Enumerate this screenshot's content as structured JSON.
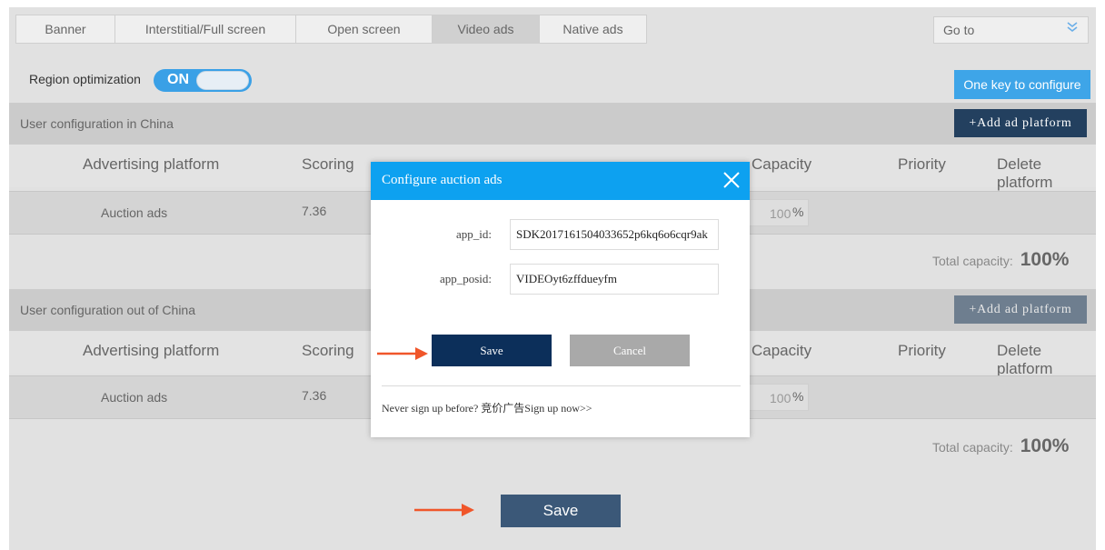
{
  "tabs": [
    {
      "label": "Banner",
      "active": false
    },
    {
      "label": "Interstitial/Full screen",
      "active": false
    },
    {
      "label": "Open screen",
      "active": false
    },
    {
      "label": "Video ads",
      "active": true
    },
    {
      "label": "Native ads",
      "active": false
    }
  ],
  "goto": {
    "label": "Go to",
    "icon": "double-chevron-down-icon"
  },
  "region": {
    "label": "Region optimization",
    "toggle": "ON"
  },
  "one_key_label": "One key to configure",
  "columns": [
    "Advertising platform",
    "Scoring",
    "Capacity",
    "Priority",
    "Delete platform"
  ],
  "china": {
    "title": "User configuration in China",
    "add_label": "+Add ad platform",
    "row": {
      "platform": "Auction ads",
      "score": "7.36",
      "capacity": "100",
      "pct": "%"
    },
    "total_label": "Total capacity:",
    "total_value": "100%"
  },
  "abroad": {
    "title": "User configuration out of China",
    "add_label": "+Add ad platform",
    "row": {
      "platform": "Auction ads",
      "score": "7.36",
      "capacity": "100",
      "pct": "%"
    },
    "total_label": "Total capacity:",
    "total_value": "100%"
  },
  "save_label": "Save",
  "modal": {
    "title": "Configure auction ads",
    "app_id_label": "app_id:",
    "app_id_value": "SDK2017161504033652p6kq6o6cqr9ak",
    "app_posid_label": "app_posid:",
    "app_posid_value": "VIDEOyt6zffdueyfm",
    "save_label": "Save",
    "cancel_label": "Cancel",
    "signup_text": "Never sign up before? 竞价广告Sign up now>>"
  },
  "colors": {
    "accent": "#0da1f0",
    "dark_button": "#23405f",
    "arrow": "#f0562a"
  }
}
